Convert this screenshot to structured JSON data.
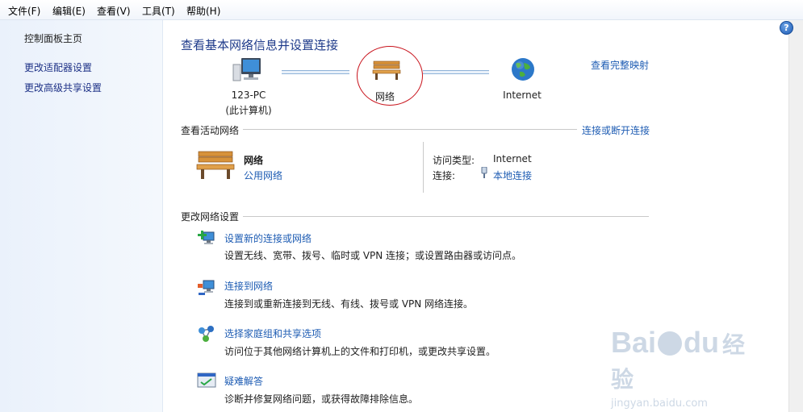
{
  "menubar": {
    "items": [
      {
        "label": "文件(F)"
      },
      {
        "label": "编辑(E)"
      },
      {
        "label": "查看(V)"
      },
      {
        "label": "工具(T)"
      },
      {
        "label": "帮助(H)"
      }
    ]
  },
  "sidebar": {
    "home": "控制面板主页",
    "links": [
      {
        "label": "更改适配器设置"
      },
      {
        "label": "更改高级共享设置"
      }
    ]
  },
  "main": {
    "title": "查看基本网络信息并设置连接",
    "full_map_link": "查看完整映射",
    "map": {
      "computer_name": "123-PC",
      "computer_note": "(此计算机)",
      "network": "网络",
      "internet": "Internet"
    },
    "active": {
      "heading": "查看活动网络",
      "connect_link": "连接或断开连接",
      "network_name": "网络",
      "network_type": "公用网络",
      "access_type_label": "访问类型:",
      "access_type_value": "Internet",
      "connection_label": "连接:",
      "connection_value": "本地连接"
    },
    "settings": {
      "heading": "更改网络设置",
      "tasks": [
        {
          "title": "设置新的连接或网络",
          "desc": "设置无线、宽带、拨号、临时或 VPN 连接；或设置路由器或访问点。",
          "icon": "new-connection-icon"
        },
        {
          "title": "连接到网络",
          "desc": "连接到或重新连接到无线、有线、拨号或 VPN 网络连接。",
          "icon": "connect-network-icon"
        },
        {
          "title": "选择家庭组和共享选项",
          "desc": "访问位于其他网络计算机上的文件和打印机，或更改共享设置。",
          "icon": "homegroup-icon"
        },
        {
          "title": "疑难解答",
          "desc": "诊断并修复网络问题，或获得故障排除信息。",
          "icon": "troubleshoot-icon"
        }
      ]
    }
  },
  "watermark": {
    "brand": "Bai",
    "brand2": "du",
    "brand3": "经验",
    "url": "jingyan.baidu.com"
  },
  "colors": {
    "link": "#1e5cb3",
    "title": "#1e3a8a",
    "annotation": "#c8121b"
  }
}
